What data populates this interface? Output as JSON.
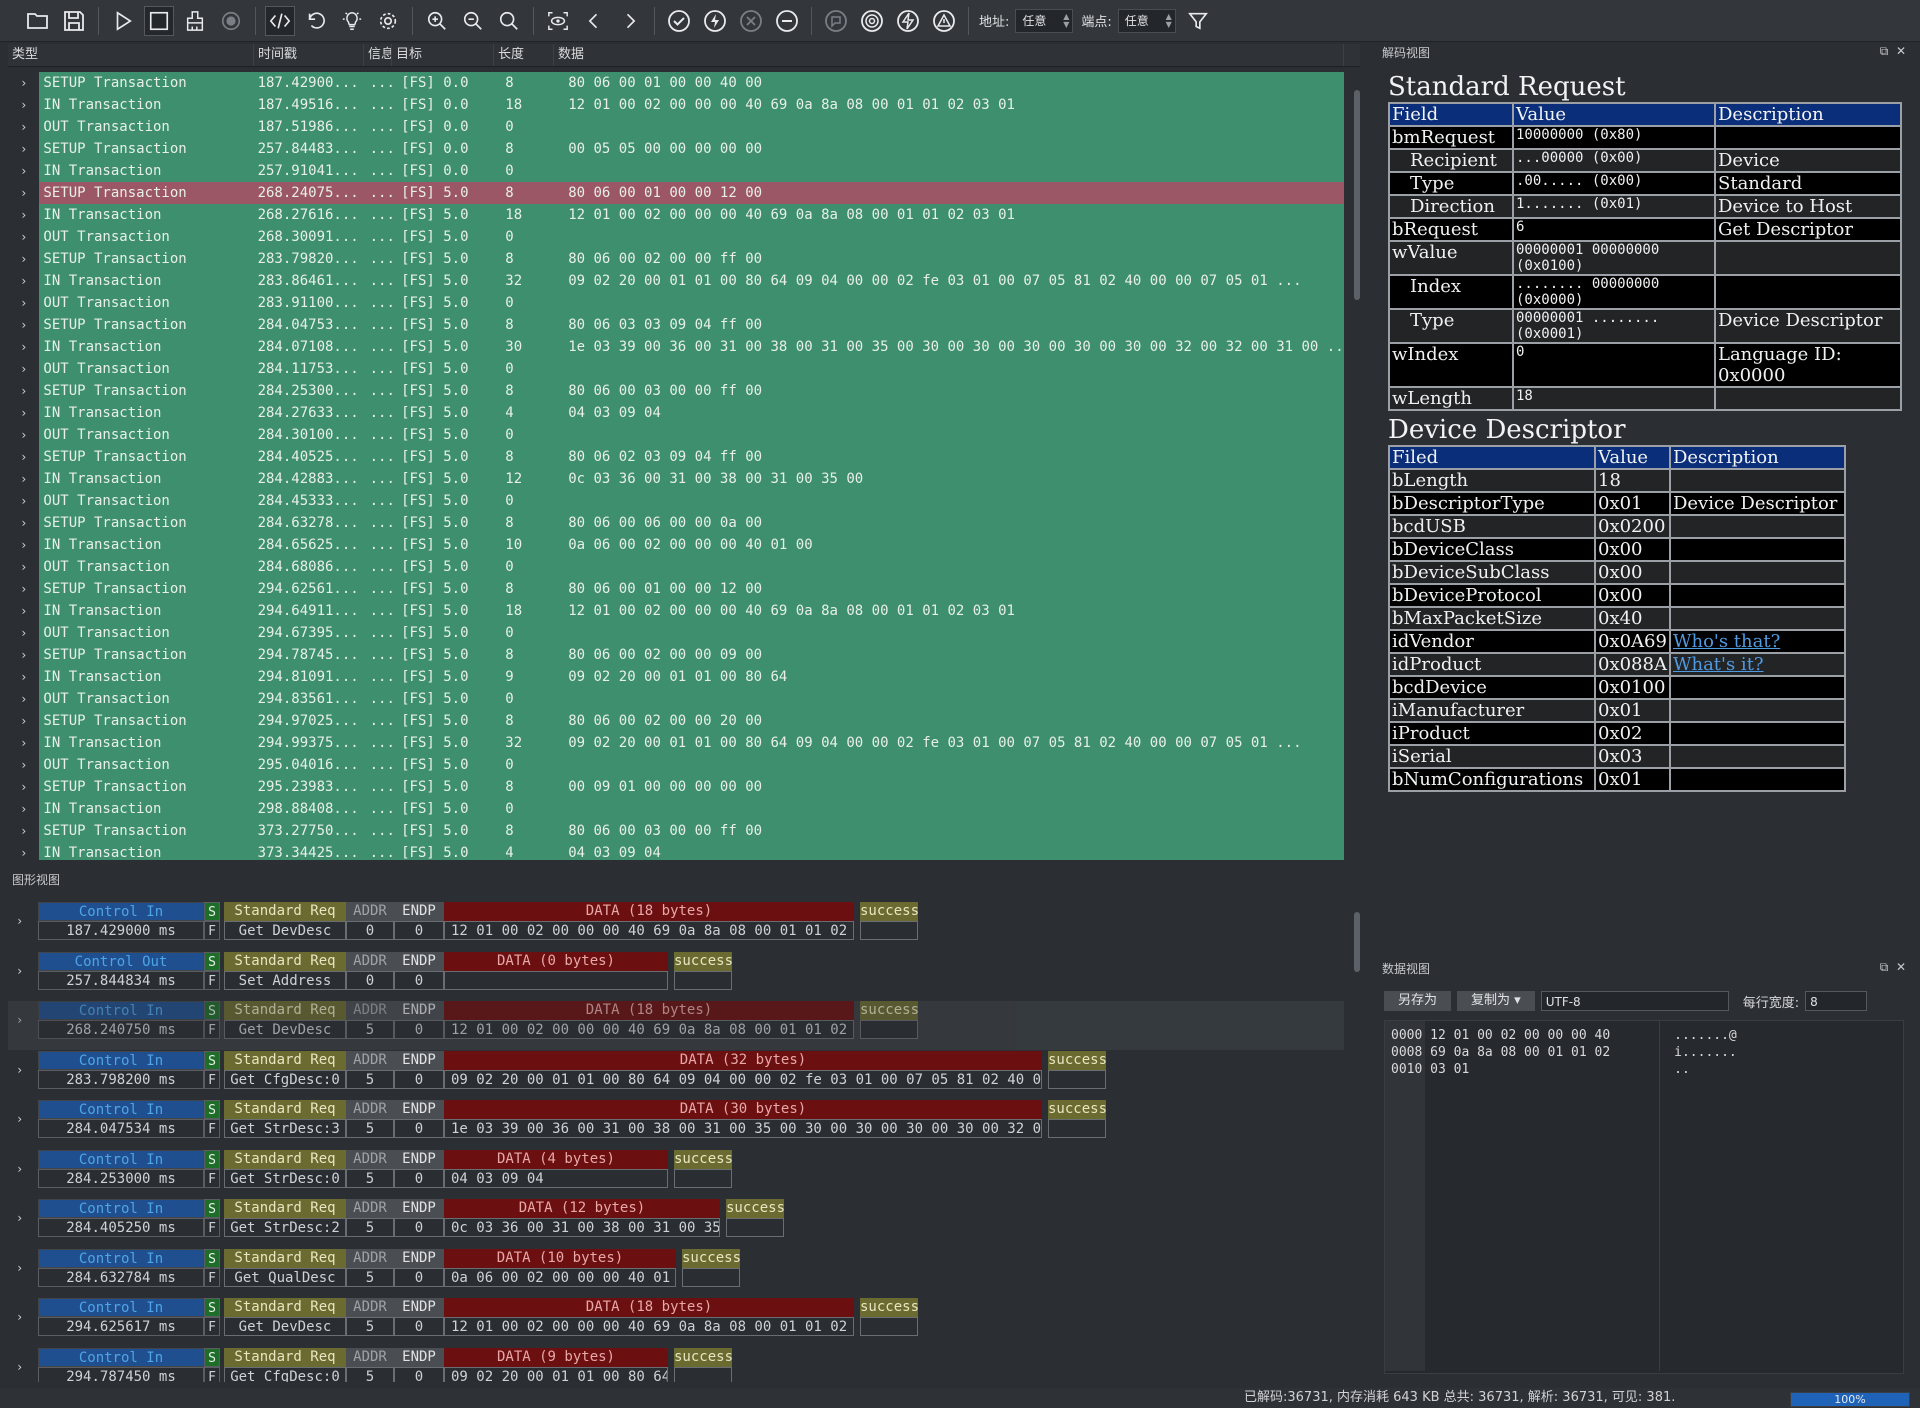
{
  "toolbar": {
    "address_label": "地址:",
    "address_value": "任意",
    "endpoint_label": "端点:",
    "endpoint_value": "任意"
  },
  "list": {
    "columns": [
      "类型",
      "时间戳",
      "信息",
      "目标",
      "长度",
      "数据"
    ],
    "rows": [
      {
        "type": "SETUP Transaction",
        "time": "187.42900...",
        "info": "...",
        "target": "[FS] 0.0",
        "len": "8",
        "data": "80 06 00 01 00 00 40 00"
      },
      {
        "type": "IN Transaction",
        "time": "187.49516...",
        "info": "...",
        "target": "[FS] 0.0",
        "len": "18",
        "data": "12 01 00 02 00 00 00 40 69 0a 8a 08 00 01 01 02 03 01"
      },
      {
        "type": "OUT Transaction",
        "time": "187.51986...",
        "info": "...",
        "target": "[FS] 0.0",
        "len": "0",
        "data": ""
      },
      {
        "type": "SETUP Transaction",
        "time": "257.84483...",
        "info": "...",
        "target": "[FS] 0.0",
        "len": "8",
        "data": "00 05 05 00 00 00 00 00"
      },
      {
        "type": "IN Transaction",
        "time": "257.91041...",
        "info": "...",
        "target": "[FS] 0.0",
        "len": "0",
        "data": ""
      },
      {
        "type": "SETUP Transaction",
        "time": "268.24075...",
        "info": "...",
        "target": "[FS] 5.0",
        "len": "8",
        "data": "80 06 00 01 00 00 12 00",
        "selected": true
      },
      {
        "type": "IN Transaction",
        "time": "268.27616...",
        "info": "...",
        "target": "[FS] 5.0",
        "len": "18",
        "data": "12 01 00 02 00 00 00 40 69 0a 8a 08 00 01 01 02 03 01"
      },
      {
        "type": "OUT Transaction",
        "time": "268.30091...",
        "info": "...",
        "target": "[FS] 5.0",
        "len": "0",
        "data": ""
      },
      {
        "type": "SETUP Transaction",
        "time": "283.79820...",
        "info": "...",
        "target": "[FS] 5.0",
        "len": "8",
        "data": "80 06 00 02 00 00 ff 00"
      },
      {
        "type": "IN Transaction",
        "time": "283.86461...",
        "info": "...",
        "target": "[FS] 5.0",
        "len": "32",
        "data": "09 02 20 00 01 01 00 80 64 09 04 00 00 02 fe 03 01 00 07 05 81 02 40 00 00 07 05 01 ..."
      },
      {
        "type": "OUT Transaction",
        "time": "283.91100...",
        "info": "...",
        "target": "[FS] 5.0",
        "len": "0",
        "data": ""
      },
      {
        "type": "SETUP Transaction",
        "time": "284.04753...",
        "info": "...",
        "target": "[FS] 5.0",
        "len": "8",
        "data": "80 06 03 03 09 04 ff 00"
      },
      {
        "type": "IN Transaction",
        "time": "284.07108...",
        "info": "...",
        "target": "[FS] 5.0",
        "len": "30",
        "data": "1e 03 39 00 36 00 31 00 38 00 31 00 35 00 30 00 30 00 30 00 30 00 30 00 32 00 32 00 31 00 ..."
      },
      {
        "type": "OUT Transaction",
        "time": "284.11753...",
        "info": "...",
        "target": "[FS] 5.0",
        "len": "0",
        "data": ""
      },
      {
        "type": "SETUP Transaction",
        "time": "284.25300...",
        "info": "...",
        "target": "[FS] 5.0",
        "len": "8",
        "data": "80 06 00 03 00 00 ff 00"
      },
      {
        "type": "IN Transaction",
        "time": "284.27633...",
        "info": "...",
        "target": "[FS] 5.0",
        "len": "4",
        "data": "04 03 09 04"
      },
      {
        "type": "OUT Transaction",
        "time": "284.30100...",
        "info": "...",
        "target": "[FS] 5.0",
        "len": "0",
        "data": ""
      },
      {
        "type": "SETUP Transaction",
        "time": "284.40525...",
        "info": "...",
        "target": "[FS] 5.0",
        "len": "8",
        "data": "80 06 02 03 09 04 ff 00"
      },
      {
        "type": "IN Transaction",
        "time": "284.42883...",
        "info": "...",
        "target": "[FS] 5.0",
        "len": "12",
        "data": "0c 03 36 00 31 00 38 00 31 00 35 00"
      },
      {
        "type": "OUT Transaction",
        "time": "284.45333...",
        "info": "...",
        "target": "[FS] 5.0",
        "len": "0",
        "data": ""
      },
      {
        "type": "SETUP Transaction",
        "time": "284.63278...",
        "info": "...",
        "target": "[FS] 5.0",
        "len": "8",
        "data": "80 06 00 06 00 00 0a 00"
      },
      {
        "type": "IN Transaction",
        "time": "284.65625...",
        "info": "...",
        "target": "[FS] 5.0",
        "len": "10",
        "data": "0a 06 00 02 00 00 00 40 01 00"
      },
      {
        "type": "OUT Transaction",
        "time": "284.68086...",
        "info": "...",
        "target": "[FS] 5.0",
        "len": "0",
        "data": ""
      },
      {
        "type": "SETUP Transaction",
        "time": "294.62561...",
        "info": "...",
        "target": "[FS] 5.0",
        "len": "8",
        "data": "80 06 00 01 00 00 12 00"
      },
      {
        "type": "IN Transaction",
        "time": "294.64911...",
        "info": "...",
        "target": "[FS] 5.0",
        "len": "18",
        "data": "12 01 00 02 00 00 00 40 69 0a 8a 08 00 01 01 02 03 01"
      },
      {
        "type": "OUT Transaction",
        "time": "294.67395...",
        "info": "...",
        "target": "[FS] 5.0",
        "len": "0",
        "data": ""
      },
      {
        "type": "SETUP Transaction",
        "time": "294.78745...",
        "info": "...",
        "target": "[FS] 5.0",
        "len": "8",
        "data": "80 06 00 02 00 00 09 00"
      },
      {
        "type": "IN Transaction",
        "time": "294.81091...",
        "info": "...",
        "target": "[FS] 5.0",
        "len": "9",
        "data": "09 02 20 00 01 01 00 80 64"
      },
      {
        "type": "OUT Transaction",
        "time": "294.83561...",
        "info": "...",
        "target": "[FS] 5.0",
        "len": "0",
        "data": ""
      },
      {
        "type": "SETUP Transaction",
        "time": "294.97025...",
        "info": "...",
        "target": "[FS] 5.0",
        "len": "8",
        "data": "80 06 00 02 00 00 20 00"
      },
      {
        "type": "IN Transaction",
        "time": "294.99375...",
        "info": "...",
        "target": "[FS] 5.0",
        "len": "32",
        "data": "09 02 20 00 01 01 00 80 64 09 04 00 00 02 fe 03 01 00 07 05 81 02 40 00 00 07 05 01 ..."
      },
      {
        "type": "OUT Transaction",
        "time": "295.04016...",
        "info": "...",
        "target": "[FS] 5.0",
        "len": "0",
        "data": ""
      },
      {
        "type": "SETUP Transaction",
        "time": "295.23983...",
        "info": "...",
        "target": "[FS] 5.0",
        "len": "8",
        "data": "00 09 01 00 00 00 00 00"
      },
      {
        "type": "IN Transaction",
        "time": "298.88408...",
        "info": "...",
        "target": "[FS] 5.0",
        "len": "0",
        "data": ""
      },
      {
        "type": "SETUP Transaction",
        "time": "373.27750...",
        "info": "...",
        "target": "[FS] 5.0",
        "len": "8",
        "data": "80 06 00 03 00 00 ff 00"
      },
      {
        "type": "IN Transaction",
        "time": "373.34425...",
        "info": "...",
        "target": "[FS] 5.0",
        "len": "4",
        "data": "04 03 09 04"
      }
    ]
  },
  "graph": {
    "title": "图形视图",
    "rows": [
      {
        "ctl": "Control In",
        "time": "187.429000 ms",
        "req": "Standard Req",
        "req_val": "Get DevDesc",
        "addr": "0",
        "endp": "0",
        "data_hdr": "DATA (18 bytes)",
        "data_val": "12 01 00 02 00 00 00 40 69 0a 8a 08 00 01 01 02 03 01",
        "status": "success"
      },
      {
        "ctl": "Control Out",
        "time": "257.844834 ms",
        "req": "Standard Req",
        "req_val": "Set Address",
        "addr": "0",
        "endp": "0",
        "data_hdr": "DATA (0 bytes)",
        "data_val": "",
        "status": "success"
      },
      {
        "ctl": "Control In",
        "time": "268.240750 ms",
        "req": "Standard Req",
        "req_val": "Get DevDesc",
        "addr": "5",
        "endp": "0",
        "data_hdr": "DATA (18 bytes)",
        "data_val": "12 01 00 02 00 00 00 40 69 0a 8a 08 00 01 01 02 03 01",
        "status": "success",
        "selected": true
      },
      {
        "ctl": "Control In",
        "time": "283.798200 ms",
        "req": "Standard Req",
        "req_val": "Get CfgDesc:0",
        "addr": "5",
        "endp": "0",
        "data_hdr": "DATA (32 bytes)",
        "data_val": "09 02 20 00 01 01 00 80 64 09 04 00 00 02 fe 03 01 00 07 05 81 02 40 00 00 0...",
        "status": "success"
      },
      {
        "ctl": "Control In",
        "time": "284.047534 ms",
        "req": "Standard Req",
        "req_val": "Get StrDesc:3",
        "addr": "5",
        "endp": "0",
        "data_hdr": "DATA (30 bytes)",
        "data_val": "1e 03 39 00 36 00 31 00 38 00 31 00 35 00 30 00 30 00 30 00 30 00 32 00 32 0...",
        "status": "success"
      },
      {
        "ctl": "Control In",
        "time": "284.253000 ms",
        "req": "Standard Req",
        "req_val": "Get StrDesc:0",
        "addr": "5",
        "endp": "0",
        "data_hdr": "DATA (4 bytes)",
        "data_val": "04 03 09 04",
        "status": "success"
      },
      {
        "ctl": "Control In",
        "time": "284.405250 ms",
        "req": "Standard Req",
        "req_val": "Get StrDesc:2",
        "addr": "5",
        "endp": "0",
        "data_hdr": "DATA (12 bytes)",
        "data_val": "0c 03 36 00 31 00 38 00 31 00 35 00",
        "status": "success"
      },
      {
        "ctl": "Control In",
        "time": "284.632784 ms",
        "req": "Standard Req",
        "req_val": "Get QualDesc",
        "addr": "5",
        "endp": "0",
        "data_hdr": "DATA (10 bytes)",
        "data_val": "0a 06 00 02 00 00 00 40 01 00",
        "status": "success"
      },
      {
        "ctl": "Control In",
        "time": "294.625617 ms",
        "req": "Standard Req",
        "req_val": "Get DevDesc",
        "addr": "5",
        "endp": "0",
        "data_hdr": "DATA (18 bytes)",
        "data_val": "12 01 00 02 00 00 00 40 69 0a 8a 08 00 01 01 02 03 01",
        "status": "success"
      },
      {
        "ctl": "Control In",
        "time": "294.787450 ms",
        "req": "Standard Req",
        "req_val": "Get CfgDesc:0",
        "addr": "5",
        "endp": "0",
        "data_hdr": "DATA (9 bytes)",
        "data_val": "09 02 20 00 01 01 00 80 64",
        "status": "success"
      }
    ],
    "s_label": "S",
    "f_label": "F",
    "addr_label": "ADDR",
    "endp_label": "ENDP"
  },
  "decode": {
    "title": "解码视图",
    "req_title": "Standard Request",
    "req_headers": [
      "Field",
      "Value",
      "Description"
    ],
    "req_rows": [
      {
        "f": "bmRequest",
        "v": "10000000 (0x80)",
        "d": "",
        "indent": false
      },
      {
        "f": "Recipient",
        "v": "...00000 (0x00)",
        "d": "Device",
        "indent": true
      },
      {
        "f": "Type",
        "v": ".00..... (0x00)",
        "d": "Standard",
        "indent": true
      },
      {
        "f": "Direction",
        "v": "1....... (0x01)",
        "d": "Device to Host",
        "indent": true
      },
      {
        "f": "bRequest",
        "v": "6",
        "d": "Get Descriptor",
        "indent": false
      },
      {
        "f": "wValue",
        "v": "00000001 00000000 (0x0100)",
        "d": "",
        "indent": false
      },
      {
        "f": "Index",
        "v": "........ 00000000 (0x0000)",
        "d": "",
        "indent": true
      },
      {
        "f": "Type",
        "v": "00000001 ........ (0x0001)",
        "d": "Device Descriptor",
        "indent": true
      },
      {
        "f": "wIndex",
        "v": "0",
        "d": "Language ID: 0x0000",
        "indent": false
      },
      {
        "f": "wLength",
        "v": "18",
        "d": "",
        "indent": false
      }
    ],
    "dev_title": "Device Descriptor",
    "dev_headers": [
      "Filed",
      "Value",
      "Description"
    ],
    "dev_rows": [
      {
        "f": "bLength",
        "v": "18",
        "d": ""
      },
      {
        "f": "bDescriptorType",
        "v": "0x01",
        "d": "Device Descriptor"
      },
      {
        "f": "bcdUSB",
        "v": "0x0200",
        "d": ""
      },
      {
        "f": "bDeviceClass",
        "v": "0x00",
        "d": ""
      },
      {
        "f": "bDeviceSubClass",
        "v": "0x00",
        "d": ""
      },
      {
        "f": "bDeviceProtocol",
        "v": "0x00",
        "d": ""
      },
      {
        "f": "bMaxPacketSize",
        "v": "0x40",
        "d": ""
      },
      {
        "f": "idVendor",
        "v": "0x0A69",
        "d": "Who's that?",
        "link": true
      },
      {
        "f": "idProduct",
        "v": "0x088A",
        "d": "What's it?",
        "link": true
      },
      {
        "f": "bcdDevice",
        "v": "0x0100",
        "d": ""
      },
      {
        "f": "iManufacturer",
        "v": "0x01",
        "d": ""
      },
      {
        "f": "iProduct",
        "v": "0x02",
        "d": ""
      },
      {
        "f": "iSerial",
        "v": "0x03",
        "d": ""
      },
      {
        "f": "bNumConfigurations",
        "v": "0x01",
        "d": ""
      }
    ]
  },
  "dataview": {
    "title": "数据视图",
    "save_as": "另存为",
    "copy_as": "复制为",
    "encoding": "UTF-8",
    "width_label": "每行宽度:",
    "width_value": "8",
    "hex_lines": [
      {
        "addr": "0000",
        "hex": "12 01 00 02 00 00 00 40",
        "ascii": ".......@"
      },
      {
        "addr": "0008",
        "hex": "69 0a 8a 08 00 01 01 02",
        "ascii": "i......."
      },
      {
        "addr": "0010",
        "hex": "03 01",
        "ascii": ".."
      }
    ]
  },
  "status": {
    "text": "已解码:36731, 内存消耗 643 KB   总共: 36731, 解析: 36731, 可见: 381.",
    "progress_pct": 100,
    "progress_label": "100%"
  }
}
